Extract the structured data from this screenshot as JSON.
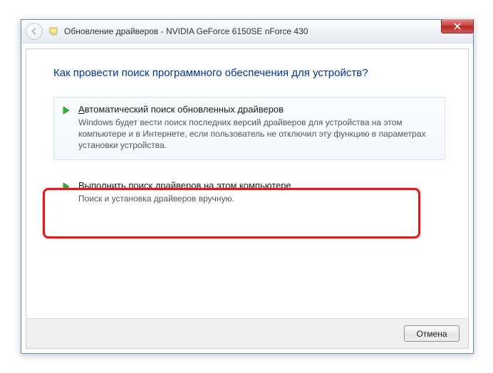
{
  "window": {
    "title": "Обновление драйверов - NVIDIA GeForce 6150SE nForce 430"
  },
  "page": {
    "heading": "Как провести поиск программного обеспечения для устройств?"
  },
  "options": {
    "auto": {
      "title_pre": "А",
      "title_rest": "втоматический поиск обновленных драйверов",
      "desc": "Windows будет вести поиск последних версий драйверов для устройства на этом компьютере и в Интернете, если пользователь не отключил эту функцию в параметрах установки устройства."
    },
    "manual": {
      "title_pre": "В",
      "title_rest": "ыполнить поиск драйверов на этом компьютере",
      "desc": "Поиск и установка драйверов вручную."
    }
  },
  "footer": {
    "cancel": "Отмена"
  }
}
